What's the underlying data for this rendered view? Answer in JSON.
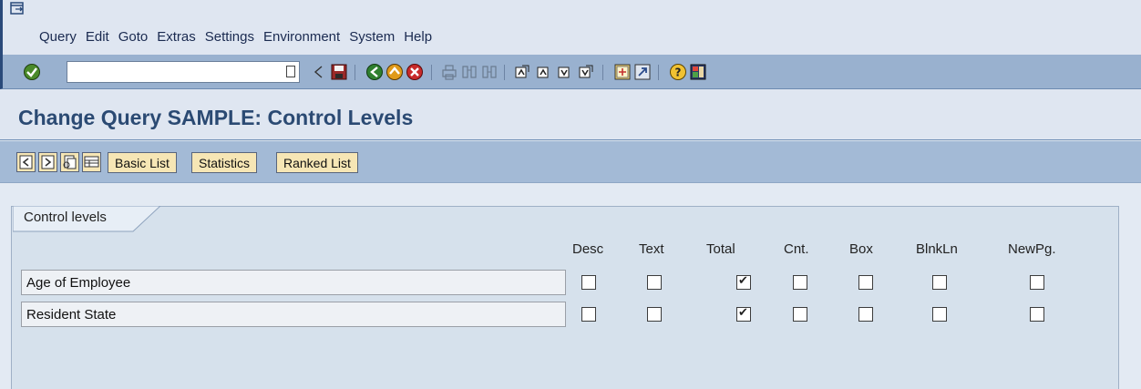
{
  "menubar": {
    "items": [
      {
        "label": "Query",
        "underline": "Q",
        "rest": "uery"
      },
      {
        "label": "Edit",
        "underline": "E",
        "rest": "dit"
      },
      {
        "label": "Goto",
        "underline": "G",
        "rest": "oto"
      },
      {
        "label": "Extras",
        "underline": "",
        "rest": "Extras"
      },
      {
        "label": "Settings",
        "underline": "S",
        "rest": "ettings"
      },
      {
        "label": "Environment",
        "underline": "",
        "rest": "Environment"
      },
      {
        "label": "System",
        "underline": "",
        "rest": "System"
      },
      {
        "label": "Help",
        "underline": "H",
        "rest": "elp"
      }
    ]
  },
  "toolbar": {
    "command_field_value": "",
    "icons": [
      "enter-icon",
      "back-triangle-icon",
      "save-icon",
      "back-icon",
      "exit-icon",
      "cancel-icon",
      "print-icon",
      "find-icon",
      "find-next-icon",
      "first-page-icon",
      "previous-page-icon",
      "next-page-icon",
      "last-page-icon",
      "create-session-icon",
      "shortcut-icon",
      "help-icon",
      "layout-menu-icon"
    ]
  },
  "title": "Change Query SAMPLE: Control Levels",
  "app_toolbar": {
    "buttons": [
      {
        "label": "Basic List"
      },
      {
        "label": "Statistics"
      },
      {
        "label": "Ranked List"
      }
    ]
  },
  "panel": {
    "tab_label": "Control levels",
    "columns": [
      "Desc",
      "Text",
      "Total",
      "Cnt.",
      "Box",
      "BlnkLn",
      "NewPg."
    ],
    "rows": [
      {
        "label": "Age of Employee",
        "checks": [
          false,
          false,
          true,
          false,
          false,
          false,
          false
        ]
      },
      {
        "label": "Resident State",
        "checks": [
          false,
          false,
          true,
          false,
          false,
          false,
          false
        ]
      }
    ]
  },
  "colors": {
    "title": "#2b4a73",
    "toolbar": "#99b1cf",
    "app_toolbar": "#a3bad6",
    "button": "#f6e6b5"
  }
}
